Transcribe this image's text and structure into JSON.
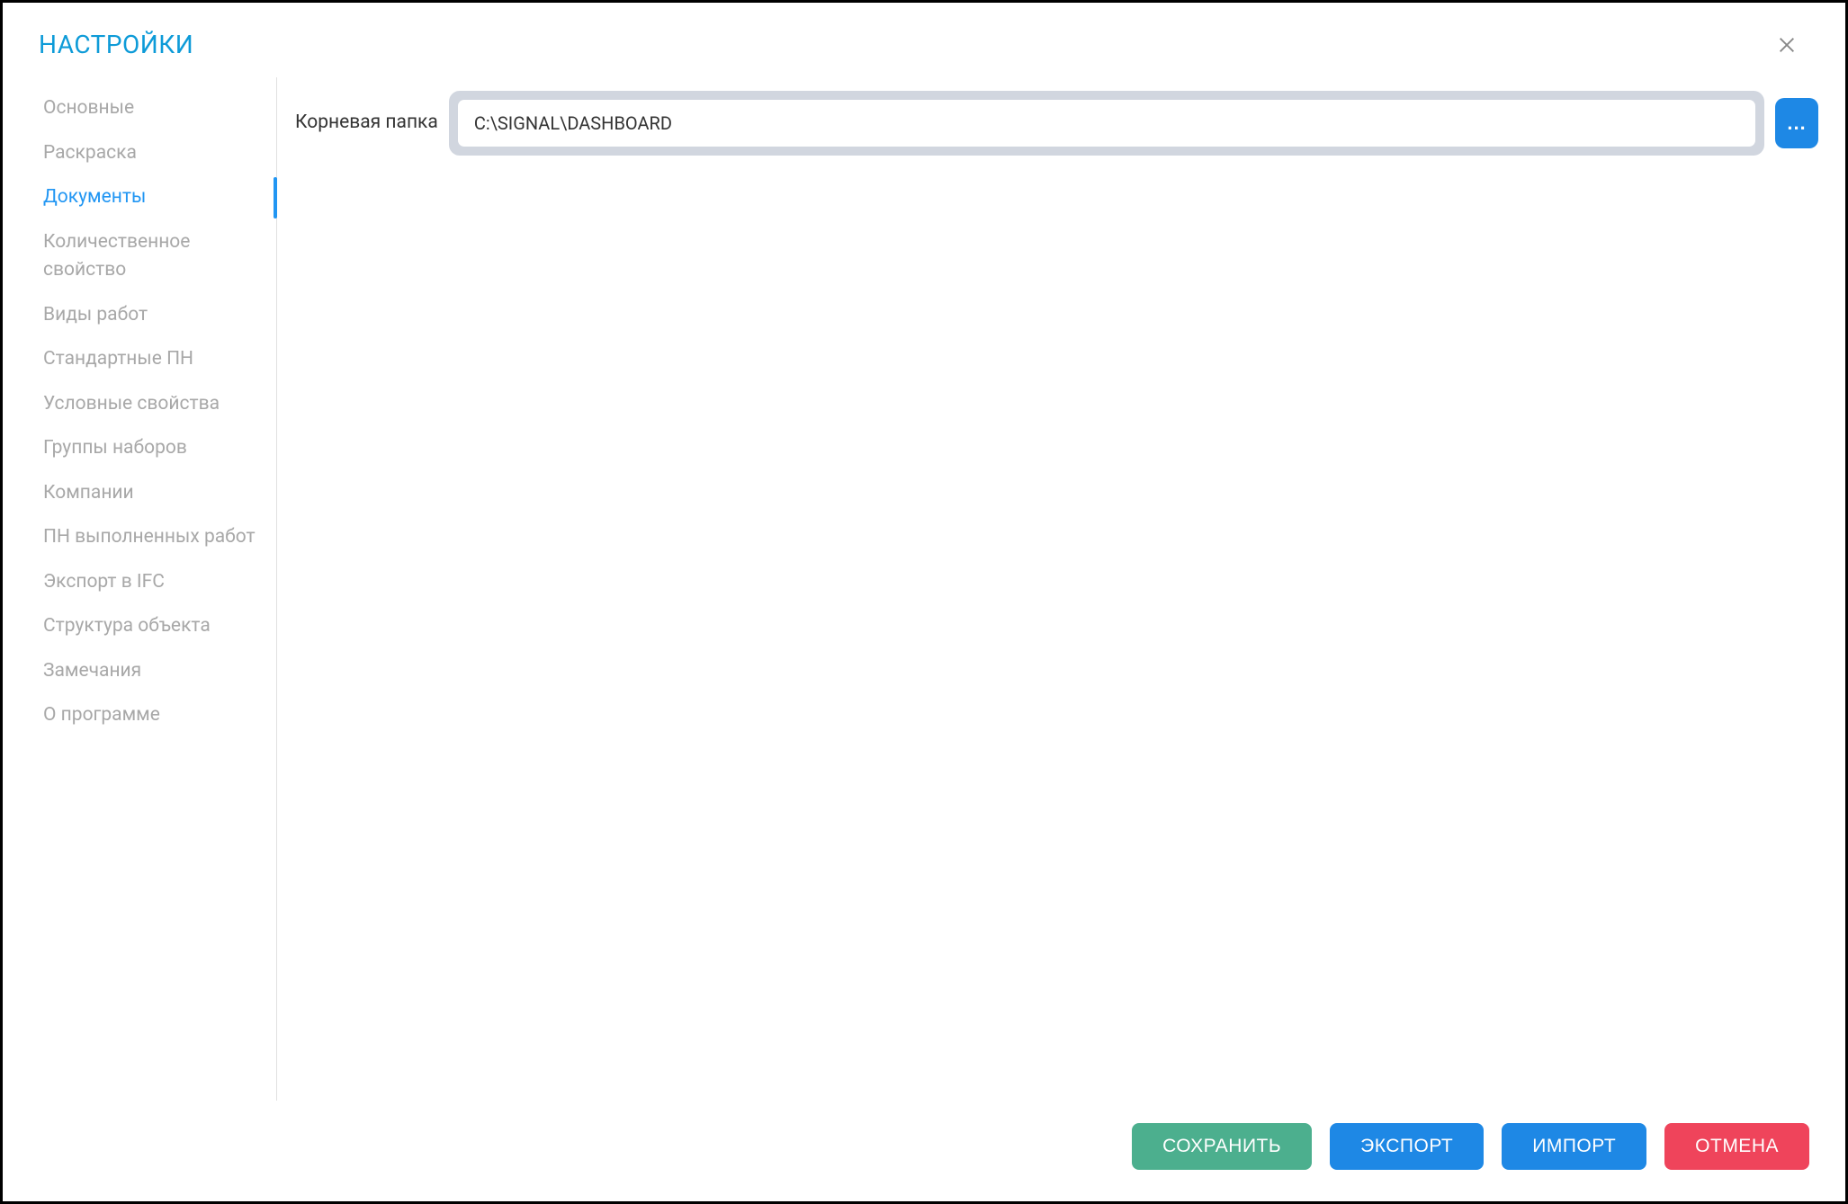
{
  "dialog": {
    "title": "НАСТРОЙКИ"
  },
  "sidebar": {
    "items": [
      {
        "label": "Основные"
      },
      {
        "label": "Раскраска"
      },
      {
        "label": "Документы"
      },
      {
        "label": "Количественное свойство"
      },
      {
        "label": "Виды работ"
      },
      {
        "label": "Стандартные ПН"
      },
      {
        "label": "Условные свойства"
      },
      {
        "label": "Группы наборов"
      },
      {
        "label": "Компании"
      },
      {
        "label": "ПН выполненных работ"
      },
      {
        "label": "Экспорт в IFC"
      },
      {
        "label": "Структура объекта"
      },
      {
        "label": "Замечания"
      },
      {
        "label": "О программе"
      }
    ],
    "active_index": 2
  },
  "content": {
    "root_folder_label": "Корневая папка",
    "root_folder_value": "C:\\SIGNAL\\DASHBOARD",
    "browse_label": "..."
  },
  "footer": {
    "save": "СОХРАНИТЬ",
    "export": "ЭКСПОРТ",
    "import": "ИМПОРТ",
    "cancel": "ОТМЕНА"
  }
}
